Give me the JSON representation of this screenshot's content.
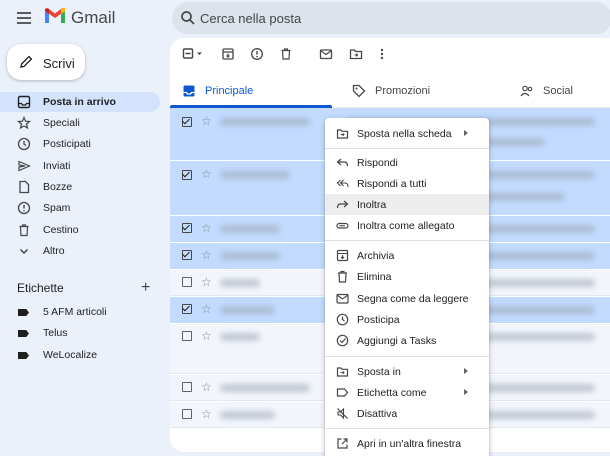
{
  "header": {
    "brand": "Gmail",
    "search_placeholder": "Cerca nella posta"
  },
  "compose": {
    "label": "Scrivi"
  },
  "sidebar": {
    "items": [
      {
        "label": "Posta in arrivo",
        "icon": "inbox-icon",
        "active": true
      },
      {
        "label": "Speciali",
        "icon": "star-icon"
      },
      {
        "label": "Posticipati",
        "icon": "clock-icon"
      },
      {
        "label": "Inviati",
        "icon": "send-icon"
      },
      {
        "label": "Bozze",
        "icon": "draft-icon"
      },
      {
        "label": "Spam",
        "icon": "spam-icon"
      },
      {
        "label": "Cestino",
        "icon": "trash-icon"
      },
      {
        "label": "Altro",
        "icon": "chevron-down-icon"
      }
    ],
    "labels_title": "Etichette",
    "labels_add": "+",
    "labels": [
      {
        "label": "5 AFM articoli"
      },
      {
        "label": "Telus"
      },
      {
        "label": "WeLocalize"
      }
    ]
  },
  "tabs": [
    {
      "label": "Principale",
      "icon": "inbox-icon",
      "active": true
    },
    {
      "label": "Promozioni",
      "icon": "tag-icon"
    },
    {
      "label": "Social",
      "icon": "people-icon"
    }
  ],
  "context_menu": {
    "items": [
      {
        "label": "Sposta nella scheda",
        "icon": "move-to-tab-icon",
        "submenu": true
      },
      {
        "label": "Rispondi",
        "icon": "reply-icon"
      },
      {
        "label": "Rispondi a tutti",
        "icon": "reply-all-icon"
      },
      {
        "label": "Inoltra",
        "icon": "forward-icon",
        "hover": true
      },
      {
        "label": "Inoltra come allegato",
        "icon": "attachment-icon"
      },
      {
        "label": "Archivia",
        "icon": "archive-icon"
      },
      {
        "label": "Elimina",
        "icon": "trash-icon"
      },
      {
        "label": "Segna come da leggere",
        "icon": "mark-unread-icon"
      },
      {
        "label": "Posticipa",
        "icon": "clock-icon"
      },
      {
        "label": "Aggiungi a Tasks",
        "icon": "add-task-icon"
      },
      {
        "label": "Sposta in",
        "icon": "folder-move-icon",
        "submenu": true
      },
      {
        "label": "Etichetta come",
        "icon": "label-icon",
        "submenu": true
      },
      {
        "label": "Disattiva",
        "icon": "mute-icon"
      },
      {
        "label": "Apri in un'altra finestra",
        "icon": "open-new-window-icon"
      }
    ]
  },
  "colors": {
    "background": "#eaf1fb",
    "selected_row": "#c2dbff",
    "accent": "#0b57d0",
    "active_nav": "#d3e3fd"
  }
}
